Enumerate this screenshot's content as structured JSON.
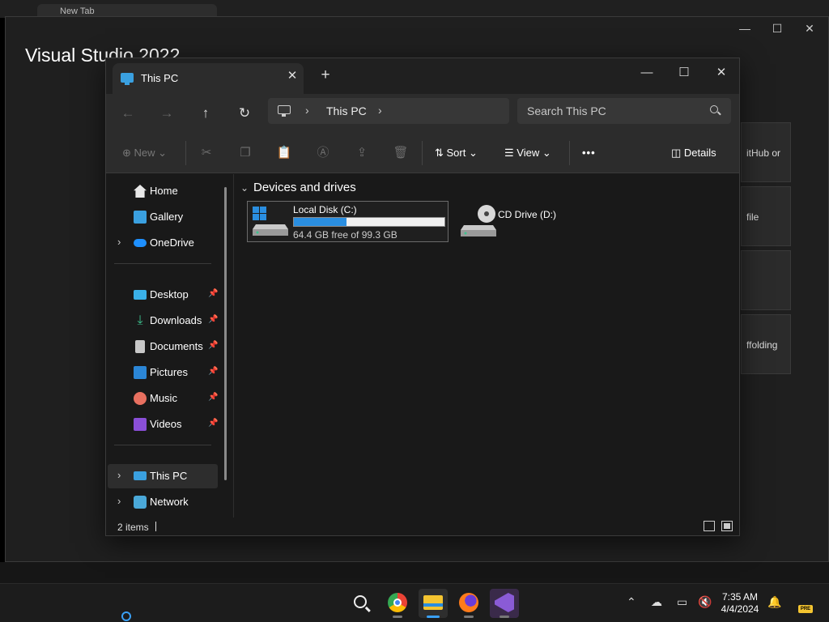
{
  "background": {
    "browser_tab_label": "New Tab",
    "vs_title": "Visual Studio 2022",
    "vs_cards": [
      "itHub or",
      "file",
      "",
      "ffolding"
    ]
  },
  "explorer": {
    "tab_title": "This PC",
    "new_tab_glyph": "+",
    "address": {
      "crumb": "This PC"
    },
    "search": {
      "placeholder": "Search This PC"
    },
    "toolbar": {
      "new_label": "New",
      "sort_label": "Sort",
      "view_label": "View",
      "more_label": "•••",
      "details_label": "Details"
    },
    "sidebar": {
      "items": [
        {
          "label": "Home"
        },
        {
          "label": "Gallery"
        },
        {
          "label": "OneDrive"
        },
        {
          "label": "Desktop"
        },
        {
          "label": "Downloads"
        },
        {
          "label": "Documents"
        },
        {
          "label": "Pictures"
        },
        {
          "label": "Music"
        },
        {
          "label": "Videos"
        },
        {
          "label": "This PC"
        },
        {
          "label": "Network"
        }
      ]
    },
    "content": {
      "group_header": "Devices and drives",
      "drives": [
        {
          "name": "Local Disk (C:)",
          "free_text": "64.4 GB free of 99.3 GB",
          "used_fraction": 0.352
        },
        {
          "name": "CD Drive (D:)"
        }
      ]
    },
    "status": {
      "items_count": "2 items"
    }
  },
  "taskbar": {
    "clock_time": "7:35 AM",
    "clock_date": "4/4/2024",
    "tray_badge": "PRE"
  },
  "colors": {
    "accent": "#2a8ee0",
    "window_bg": "#191919",
    "toolbar_bg": "#2c2c2c"
  }
}
